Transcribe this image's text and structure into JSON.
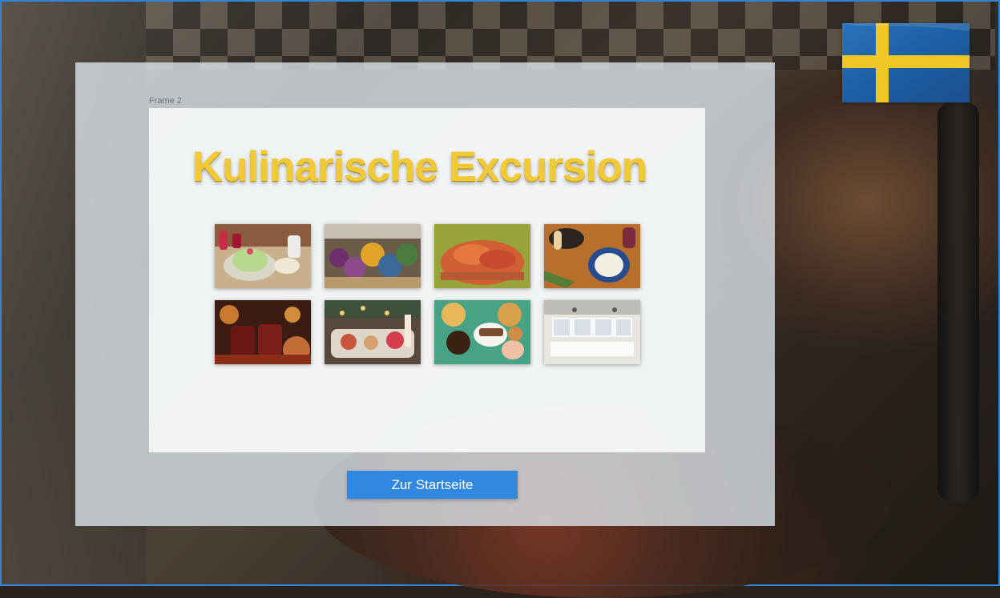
{
  "page": {
    "frame_label": "Frame 2",
    "title": "Kulinarische Excursion",
    "home_button_label": "Zur Startseite"
  },
  "gallery": {
    "images": [
      "princess-cake-photo",
      "vegetable-market-photo",
      "crayfish-platter-photo",
      "table-dinner-photo",
      "mulled-wine-photo",
      "christmas-buffet-photo",
      "fika-pastries-photo",
      "restaurant-interior-photo"
    ]
  },
  "colors": {
    "title": "#f1c937",
    "button": "#3188e0",
    "flag_blue": "#1f63a8",
    "flag_yellow": "#f0c626"
  },
  "icons": {
    "flag": "sweden-flag-icon"
  }
}
